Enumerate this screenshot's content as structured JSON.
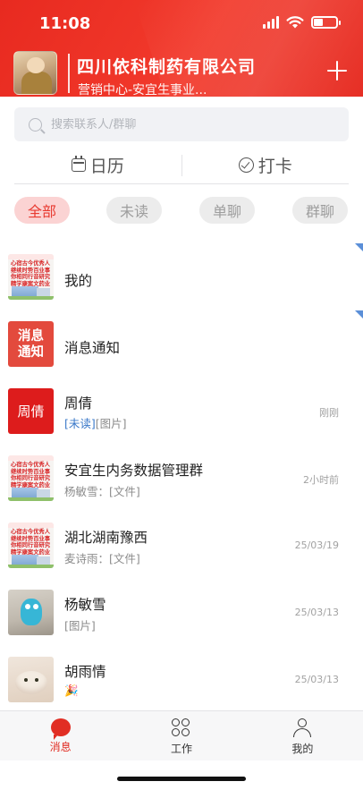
{
  "status_bar": {
    "time": "11:08"
  },
  "header": {
    "company_name": "四川依科制药有限公司",
    "department": "营销中心-安宜生事业...",
    "brand_color": "#e82a20"
  },
  "search": {
    "placeholder": "搜索联系人/群聊"
  },
  "tools": {
    "calendar_label": "日历",
    "checkin_label": "打卡"
  },
  "filters": [
    {
      "label": "全部",
      "active": true
    },
    {
      "label": "未读",
      "active": false
    },
    {
      "label": "单聊",
      "active": false
    },
    {
      "label": "群聊",
      "active": false
    }
  ],
  "poster_text": "心宿古今优秀人\n继续时势百业事\n你相同行音研究\n精学康案文药业",
  "conversations": [
    {
      "name": "我的",
      "preview": "",
      "time": "",
      "avatar": "poster",
      "pinned": true
    },
    {
      "name": "消息通知",
      "preview": "",
      "time": "",
      "avatar": "notice",
      "avatar_text": "消息\n通知",
      "pinned": true
    },
    {
      "name": "周倩",
      "preview_tag": "[未读]",
      "preview": "[图片]",
      "time": "刚刚",
      "avatar": "text",
      "avatar_text": "周倩"
    },
    {
      "name": "安宜生内务数据管理群",
      "preview": "杨敏雪：[文件]",
      "time": "2小时前",
      "avatar": "poster"
    },
    {
      "name": "湖北湖南豫西",
      "preview": "麦诗雨：[文件]",
      "time": "25/03/19",
      "avatar": "poster"
    },
    {
      "name": "杨敏雪",
      "preview": "[图片]",
      "time": "25/03/13",
      "avatar": "toy"
    },
    {
      "name": "胡雨情",
      "preview": "🎉",
      "time": "25/03/13",
      "avatar": "puppy"
    }
  ],
  "tabbar": [
    {
      "label": "消息",
      "icon": "message-icon",
      "active": true
    },
    {
      "label": "工作",
      "icon": "work-grid-icon",
      "active": false
    },
    {
      "label": "我的",
      "icon": "profile-icon",
      "active": false
    }
  ]
}
